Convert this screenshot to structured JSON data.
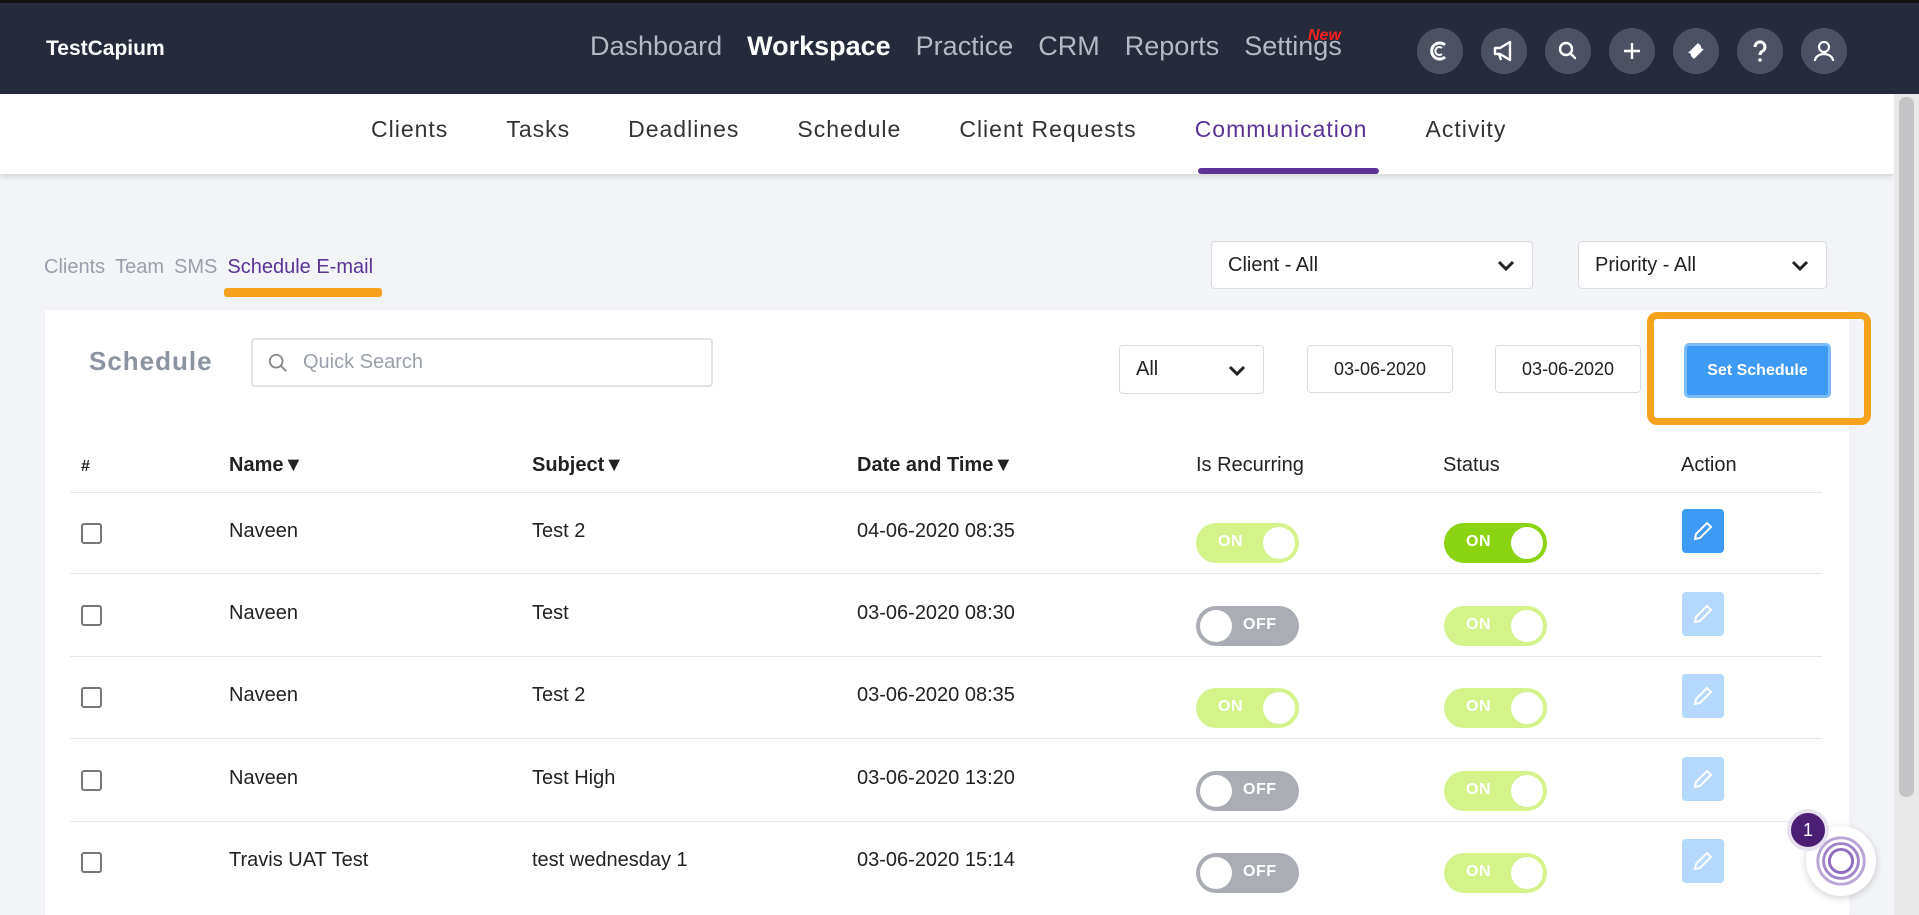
{
  "app": {
    "brand": "TestCapium"
  },
  "main_nav": {
    "items": [
      "Dashboard",
      "Workspace",
      "Practice",
      "CRM",
      "Reports",
      "Settings"
    ],
    "active": "Workspace",
    "new_tag": "New"
  },
  "top_icons": [
    "capium-logo-icon",
    "megaphone-icon",
    "search-icon",
    "plus-icon",
    "ticket-icon",
    "help-icon",
    "user-icon"
  ],
  "sub_nav": {
    "items": [
      "Clients",
      "Tasks",
      "Deadlines",
      "Schedule",
      "Client Requests",
      "Communication",
      "Activity"
    ],
    "active": "Communication"
  },
  "comm_tabs": {
    "items": [
      "Clients",
      "Team",
      "SMS",
      "Schedule E-mail"
    ],
    "active": "Schedule E-mail"
  },
  "filters": {
    "client": "Client - All",
    "priority": "Priority - All"
  },
  "schedule": {
    "title": "Schedule",
    "search_placeholder": "Quick Search",
    "type_filter": "All",
    "date_from": "03-06-2020",
    "date_to": "03-06-2020",
    "set_button": "Set Schedule"
  },
  "table": {
    "headers": {
      "num": "#",
      "name": "Name▼",
      "subject": "Subject▼",
      "datetime": "Date and Time▼",
      "recurring": "Is Recurring",
      "status": "Status",
      "action": "Action"
    },
    "rows": [
      {
        "name": "Naveen",
        "subject": "Test 2",
        "datetime": "04-06-2020 08:35",
        "recurring": "ON",
        "status": "ON",
        "editable": true
      },
      {
        "name": "Naveen",
        "subject": "Test",
        "datetime": "03-06-2020 08:30",
        "recurring": "OFF",
        "status": "ON",
        "editable": false
      },
      {
        "name": "Naveen",
        "subject": "Test 2",
        "datetime": "03-06-2020 08:35",
        "recurring": "ON",
        "status": "ON",
        "editable": false
      },
      {
        "name": "Naveen",
        "subject": "Test High",
        "datetime": "03-06-2020 13:20",
        "recurring": "OFF",
        "status": "ON",
        "editable": false
      },
      {
        "name": "Travis UAT Test",
        "subject": "test wednesday 1",
        "datetime": "03-06-2020 15:14",
        "recurring": "OFF",
        "status": "ON",
        "editable": false
      }
    ]
  },
  "chat": {
    "badge": "1"
  },
  "colors": {
    "accent": "#5a3395",
    "highlight": "#f7a21d",
    "primary_button": "#3d9bf5",
    "toggle_on": "#d4f38b",
    "toggle_on_strong": "#8ad411",
    "toggle_off": "#aaadb3",
    "topbar": "#252b3a"
  }
}
